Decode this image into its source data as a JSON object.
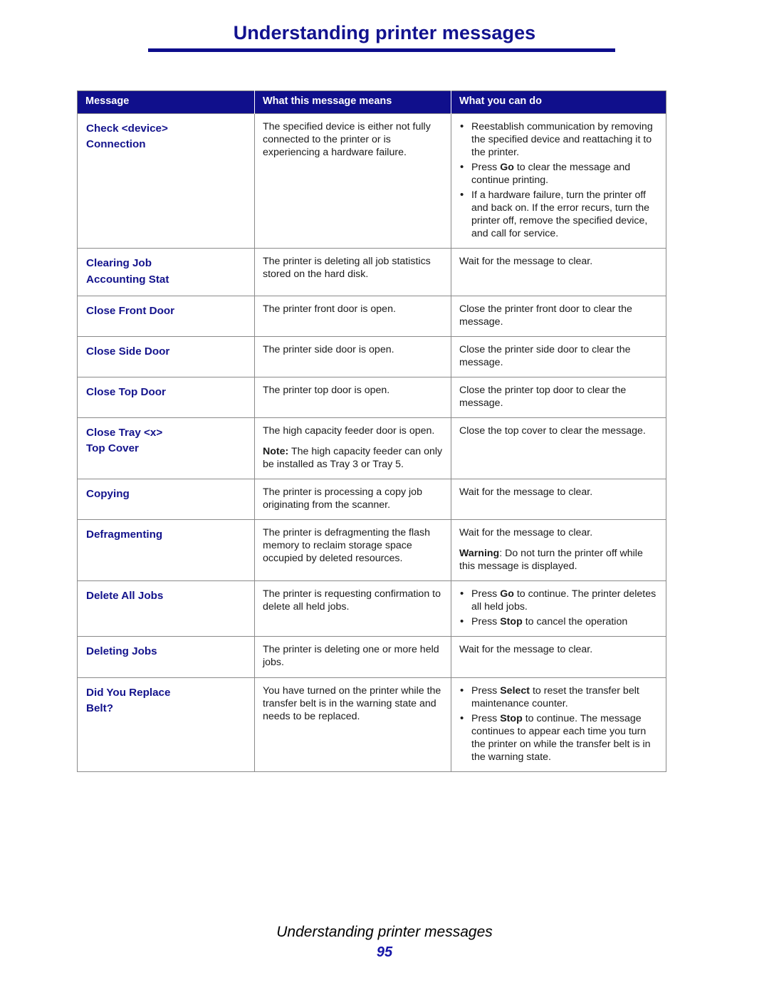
{
  "header": {
    "title": "Understanding printer messages"
  },
  "table": {
    "columns": [
      "Message",
      "What this message means",
      "What you can do"
    ],
    "rows": [
      {
        "message_lines": [
          "Check <device>",
          "Connection"
        ],
        "means": "The specified device is either not fully connected to the printer or is experiencing a hardware failure.",
        "actions": [
          "Reestablish communication by removing the specified device and reattaching it to the printer.",
          "Press Go to clear the message and continue printing.",
          "If a hardware failure, turn the printer off and back on. If the error recurs, turn the printer off, remove the specified device, and call for service."
        ],
        "actions_bold": [
          "Go"
        ]
      },
      {
        "message_lines": [
          "Clearing Job",
          "Accounting Stat"
        ],
        "means": "The printer is deleting all job statistics stored on the hard disk.",
        "action_text": "Wait for the message to clear."
      },
      {
        "message_lines": [
          "Close Front Door"
        ],
        "means": "The printer front door is open.",
        "action_text": "Close the printer front door to clear the message."
      },
      {
        "message_lines": [
          "Close Side Door"
        ],
        "means": "The printer side door is open.",
        "action_text": "Close the printer side door to clear the message."
      },
      {
        "message_lines": [
          "Close Top Door"
        ],
        "means": "The printer top door is open.",
        "action_text": "Close the printer top door to clear the message."
      },
      {
        "message_lines": [
          "Close Tray <x>",
          "Top Cover"
        ],
        "means": "The high capacity feeder door is open.",
        "note_label": "Note:",
        "note_text": " The high capacity feeder can only be installed as Tray 3 or Tray 5.",
        "action_text": "Close the top cover to clear the message."
      },
      {
        "message_lines": [
          "Copying"
        ],
        "means": "The printer is processing a copy job originating from the scanner.",
        "action_text": "Wait for the message to clear."
      },
      {
        "message_lines": [
          "Defragmenting"
        ],
        "means": "The printer is defragmenting the flash memory to reclaim storage space occupied by deleted resources.",
        "action_text": "Wait for the message to clear.",
        "warning_label": "Warning",
        "warning_text": ": Do not turn the printer off while this message is displayed."
      },
      {
        "message_lines": [
          "Delete All Jobs"
        ],
        "means": "The printer is requesting confirmation to delete all held jobs.",
        "actions": [
          "Press Go to continue. The printer deletes all held jobs.",
          "Press Stop to cancel the operation"
        ],
        "actions_bold": [
          "Go",
          "Stop"
        ]
      },
      {
        "message_lines": [
          "Deleting Jobs"
        ],
        "means": "The printer is deleting one or more held jobs.",
        "action_text": "Wait for the message to clear."
      },
      {
        "message_lines": [
          "Did You Replace",
          "Belt?"
        ],
        "means": "You have turned on the printer while the transfer belt is in the warning state and needs to be replaced.",
        "actions": [
          "Press Select to reset the transfer belt maintenance counter.",
          "Press Stop to continue. The message continues to appear each time you turn the printer on while the transfer belt is in the warning state."
        ],
        "actions_bold": [
          "Select",
          "Stop"
        ]
      }
    ]
  },
  "footer": {
    "title": "Understanding printer messages",
    "page_number": "95"
  },
  "colors": {
    "brand_navy": "#100f8c",
    "heading_blue": "#12128f",
    "table_border": "#8a8a8a"
  }
}
